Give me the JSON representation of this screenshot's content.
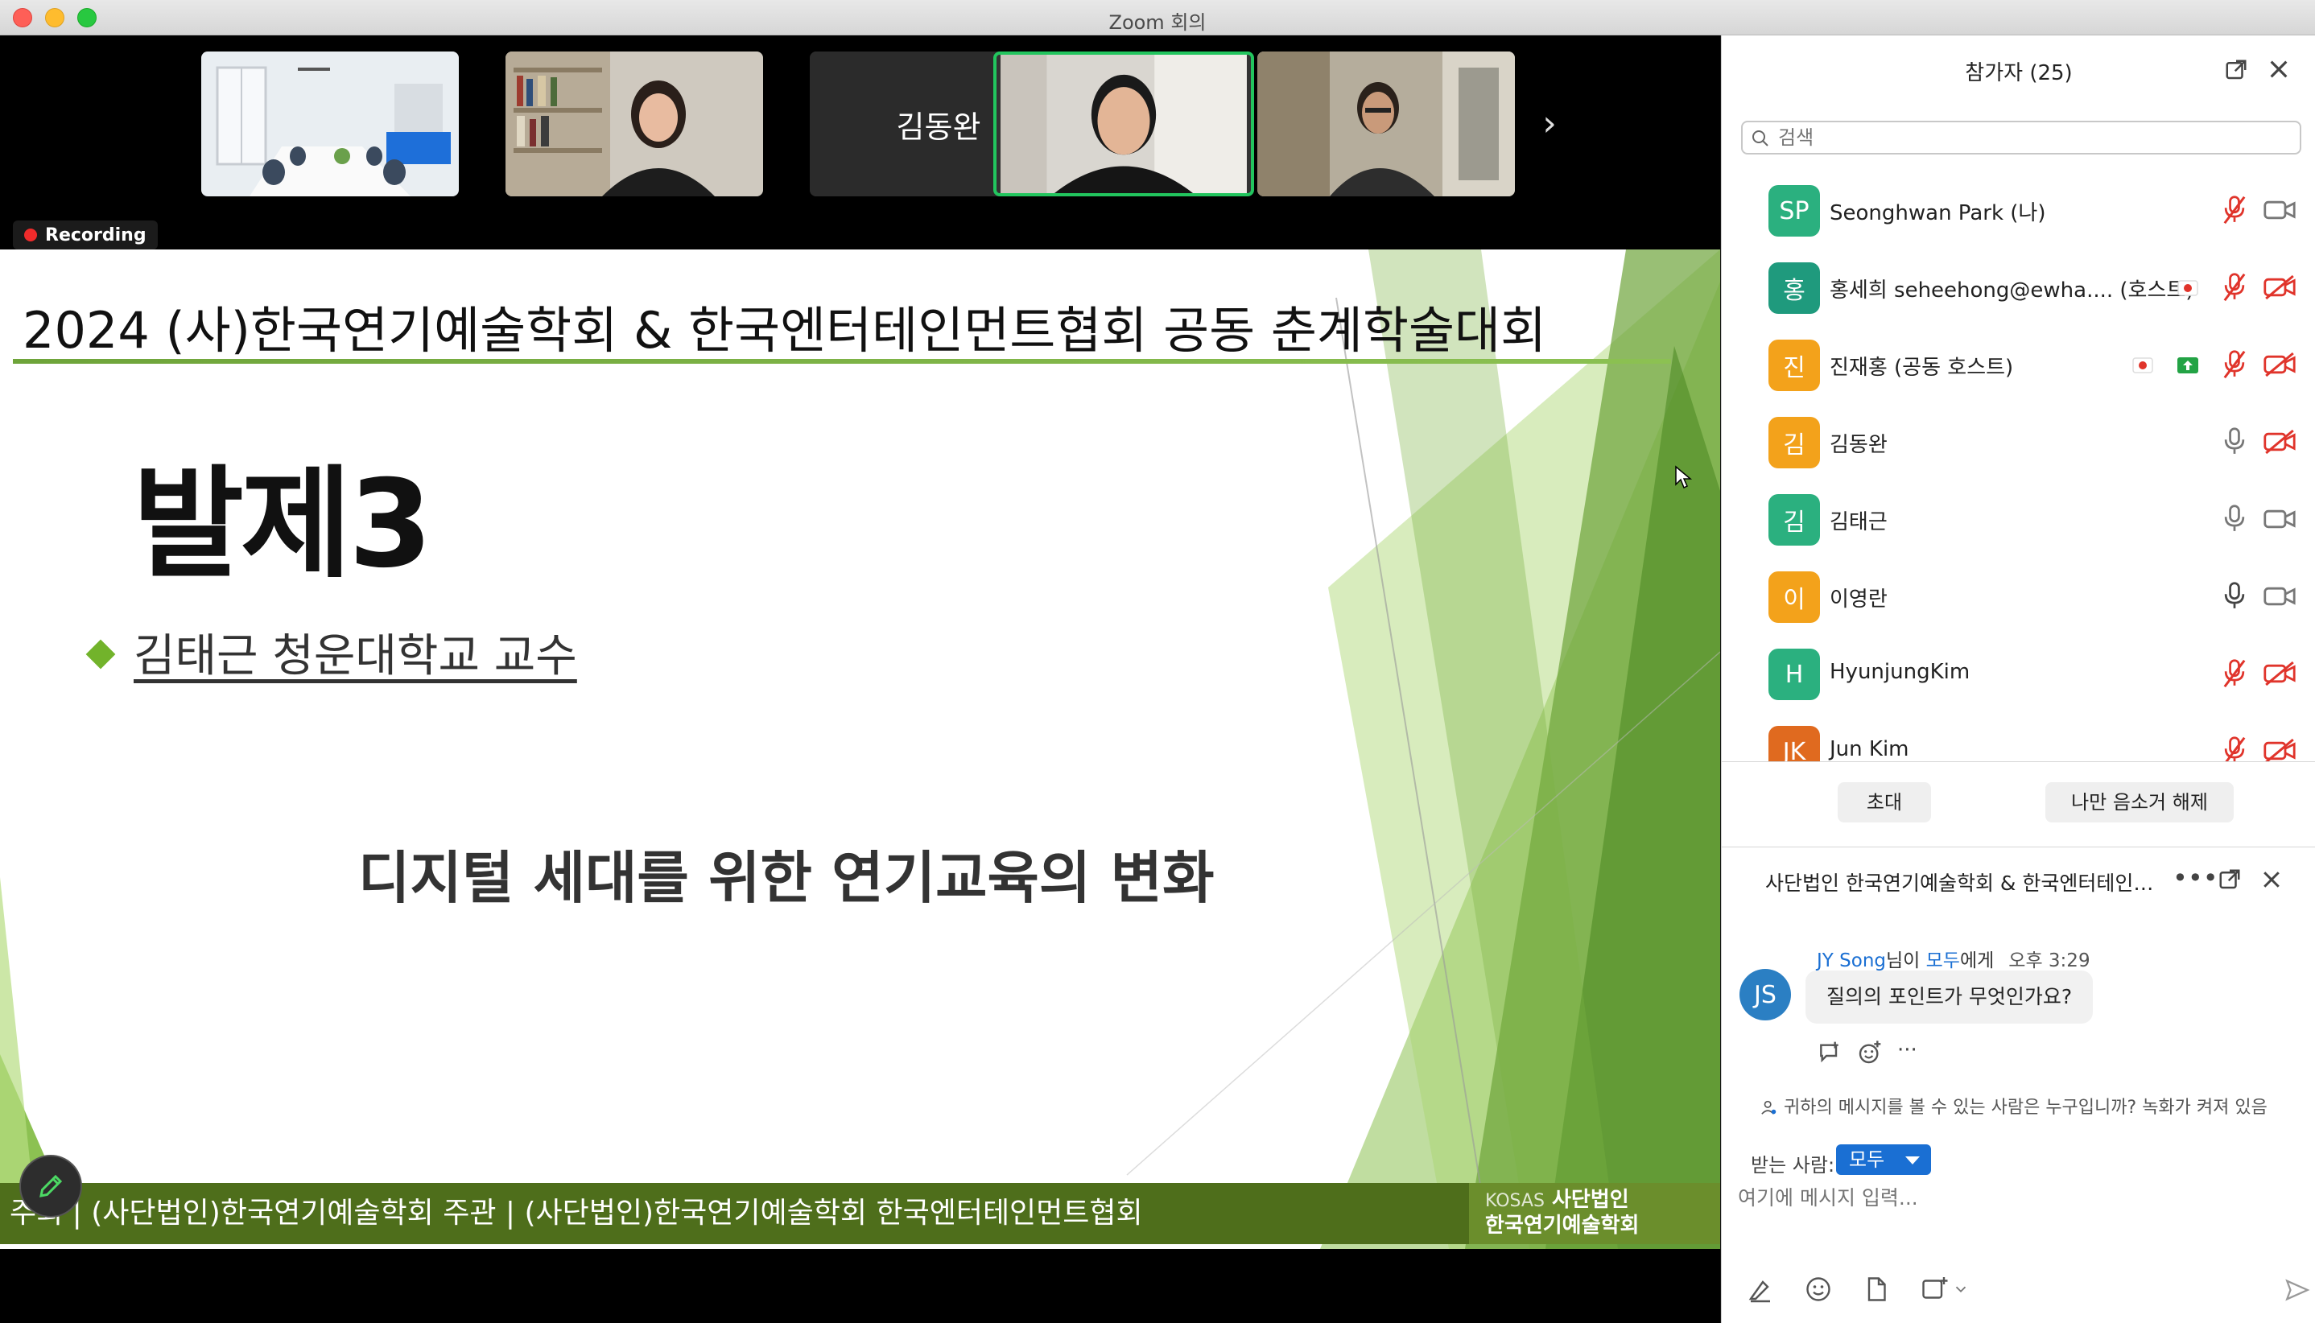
{
  "window": {
    "title": "Zoom 회의"
  },
  "video_strip": {
    "tiles": [
      {
        "type": "video",
        "scene": "meeting-room"
      },
      {
        "type": "video",
        "scene": "woman-bookshelf"
      },
      {
        "type": "name",
        "name": "김동완"
      },
      {
        "type": "video",
        "scene": "man-speaking",
        "active": true
      },
      {
        "type": "video",
        "scene": "man-glasses"
      }
    ],
    "next_label": "›"
  },
  "recording": {
    "label": "Recording"
  },
  "slide": {
    "header": "2024 (사)한국연기예술학회 & 한국엔터테인먼트협회 공동 춘계학술대회",
    "title": "발제3",
    "speaker": "김태근 청운대학교 교수",
    "subtitle": "디지털 세대를 위한 연기교육의 변화",
    "footer": "주최 | (사단법인)한국연기예술학회   주관 | (사단법인)한국연기예술학회   한국엔터테인먼트협회",
    "logo_small": "KOSAS",
    "logo_line1": "사단법인",
    "logo_line2": "한국연기예술학회"
  },
  "participants_panel": {
    "title": "참가자 (25)",
    "search_placeholder": "검색",
    "participants": [
      {
        "initials": "SP",
        "name": "Seonghwan Park (나)",
        "color": "#2bb07f",
        "mic": "muted",
        "cam": "on",
        "extras": []
      },
      {
        "initials": "홍",
        "name": "홍세희 seheehong@ewha....  (호스트)",
        "color": "#1f9a7d",
        "mic": "muted",
        "cam": "off",
        "extras": [
          "recording-dot"
        ]
      },
      {
        "initials": "진",
        "name": "진재홍 (공동 호스트)",
        "color": "#f3a21b",
        "mic": "muted",
        "cam": "off",
        "extras": [
          "recording-dot",
          "share"
        ]
      },
      {
        "initials": "김",
        "name": "김동완",
        "color": "#f3a21b",
        "mic": "on",
        "cam": "off",
        "extras": []
      },
      {
        "initials": "김",
        "name": "김태근",
        "color": "#2bb07f",
        "mic": "on",
        "cam": "on",
        "extras": []
      },
      {
        "initials": "이",
        "name": "이영란",
        "color": "#f3a21b",
        "mic": "on-dark",
        "cam": "on",
        "extras": []
      },
      {
        "initials": "H",
        "name": "HyunjungKim",
        "color": "#2bb07f",
        "mic": "muted",
        "cam": "off",
        "extras": []
      },
      {
        "initials": "JK",
        "name": "Jun Kim",
        "color": "#e06a1f",
        "mic": "muted",
        "cam": "off",
        "extras": []
      }
    ],
    "invite_label": "초대",
    "unmute_me_label": "나만 음소거 해제"
  },
  "chat": {
    "title": "사단법인 한국연기예술학회 & 한국엔터테인먼트협회...",
    "message": {
      "avatar": "JS",
      "sender": "JY Song",
      "mid": "님이 ",
      "recipient": "모두",
      "suffix": "에게",
      "time": "오후 3:29",
      "text": "질의의 포인트가 무엇인가요?"
    },
    "visibility_note": "귀하의 메시지를 볼 수 있는 사람은 누구입니까? 녹화가 켜져 있음",
    "to_label": "받는 사람:",
    "to_value": "모두",
    "input_placeholder": "여기에 메시지 입력..."
  },
  "colors": {
    "accent_blue": "#1a6fd3",
    "slide_green": "#72b32b",
    "active_speaker": "#22c55e",
    "recording_red": "#ef2b2b"
  }
}
